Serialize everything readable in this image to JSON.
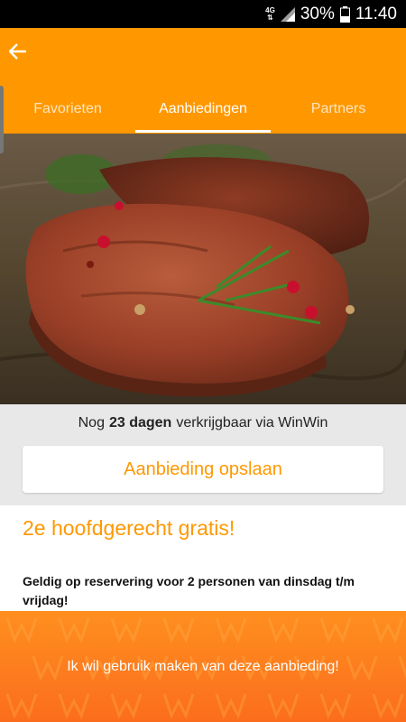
{
  "status_bar": {
    "network": "4G",
    "battery": "30%",
    "time": "11:40"
  },
  "header": {
    "back_icon": "arrow-left-icon",
    "tabs": [
      {
        "label": "Favorieten",
        "active": false
      },
      {
        "label": "Aanbiedingen",
        "active": true
      },
      {
        "label": "Partners",
        "active": false
      }
    ]
  },
  "availability": {
    "prefix": "Nog",
    "days": "23 dagen",
    "suffix": "verkrijgbaar via WinWin"
  },
  "save_button": {
    "label": "Aanbieding opslaan"
  },
  "offer": {
    "title": "2e hoofdgerecht gratis!",
    "conditions": "Geldig op reservering voor 2 personen van dinsdag t/m vrijdag!"
  },
  "cta": {
    "label": "Ik wil gebruik maken van deze aanbieding!"
  },
  "colors": {
    "accent": "#ff9800",
    "cta": "#fb7a1e"
  }
}
